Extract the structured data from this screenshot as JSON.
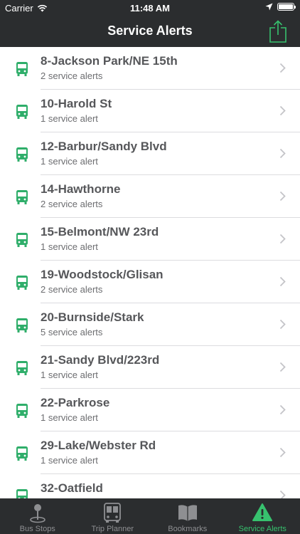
{
  "status_bar": {
    "carrier": "Carrier",
    "time": "11:48 AM"
  },
  "header": {
    "title": "Service Alerts"
  },
  "colors": {
    "accent": "#37c16e",
    "bar_bg": "#2b2d2f",
    "icon_green": "#2fae6a"
  },
  "alerts": [
    {
      "route": "8-Jackson Park/NE 15th",
      "count": "2 service alerts"
    },
    {
      "route": "10-Harold St",
      "count": "1 service alert"
    },
    {
      "route": "12-Barbur/Sandy Blvd",
      "count": "1 service alert"
    },
    {
      "route": "14-Hawthorne",
      "count": "2 service alerts"
    },
    {
      "route": "15-Belmont/NW 23rd",
      "count": "1 service alert"
    },
    {
      "route": "19-Woodstock/Glisan",
      "count": "2 service alerts"
    },
    {
      "route": "20-Burnside/Stark",
      "count": "5 service alerts"
    },
    {
      "route": "21-Sandy Blvd/223rd",
      "count": "1 service alert"
    },
    {
      "route": "22-Parkrose",
      "count": "1 service alert"
    },
    {
      "route": "29-Lake/Webster Rd",
      "count": "1 service alert"
    },
    {
      "route": "32-Oatfield",
      "count": ""
    }
  ],
  "tabs": [
    {
      "label": "Bus Stops",
      "icon": "map-pin-icon"
    },
    {
      "label": "Trip Planner",
      "icon": "bus-front-icon"
    },
    {
      "label": "Bookmarks",
      "icon": "book-icon"
    },
    {
      "label": "Service Alerts",
      "icon": "warning-icon"
    }
  ]
}
